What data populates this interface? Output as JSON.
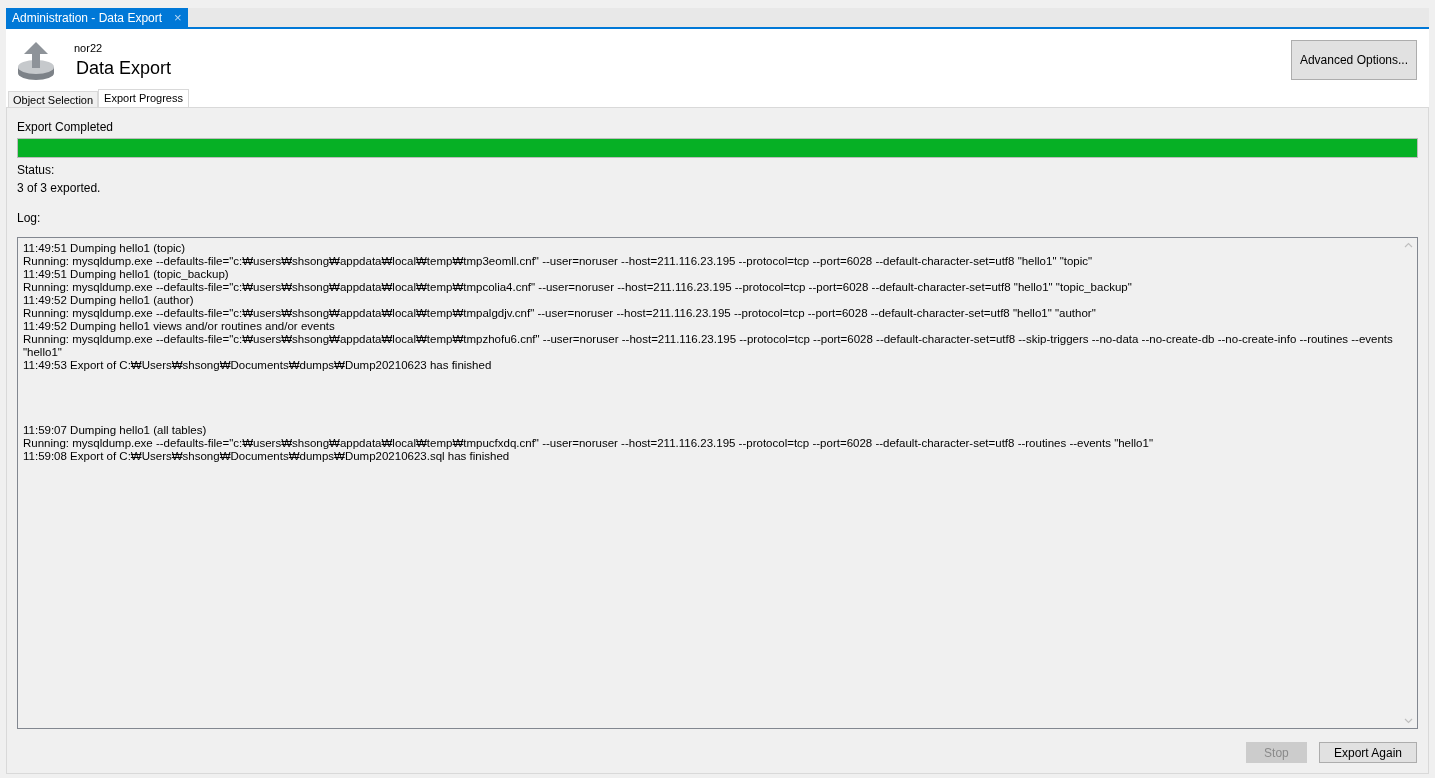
{
  "document_tab": {
    "title": "Administration - Data Export",
    "close": "×"
  },
  "header": {
    "connection": "nor22",
    "title": "Data Export",
    "advanced_button": "Advanced Options..."
  },
  "tabs": [
    {
      "label": "Object Selection",
      "selected": false
    },
    {
      "label": "Export Progress",
      "selected": true
    }
  ],
  "progress": {
    "label": "Export Completed",
    "level": 1
  },
  "status": {
    "label": "Status:",
    "value": "3 of 3 exported."
  },
  "log": {
    "label": "Log:",
    "sessions": [
      {
        "lines": [
          "11:49:51 Dumping hello1 (topic)",
          "Running: mysqldump.exe --defaults-file=\"c:₩users₩shsong₩appdata₩local₩temp₩tmp3eomll.cnf\"  --user=noruser --host=211.116.23.195 --protocol=tcp --port=6028 --default-character-set=utf8 \"hello1\" \"topic\"",
          "11:49:51 Dumping hello1 (topic_backup)",
          "Running: mysqldump.exe --defaults-file=\"c:₩users₩shsong₩appdata₩local₩temp₩tmpcolia4.cnf\"  --user=noruser --host=211.116.23.195 --protocol=tcp --port=6028 --default-character-set=utf8 \"hello1\" \"topic_backup\"",
          "11:49:52 Dumping hello1 (author)",
          "Running: mysqldump.exe --defaults-file=\"c:₩users₩shsong₩appdata₩local₩temp₩tmpalgdjv.cnf\"  --user=noruser --host=211.116.23.195 --protocol=tcp --port=6028 --default-character-set=utf8 \"hello1\" \"author\"",
          "11:49:52 Dumping hello1 views and/or routines and/or events",
          "Running: mysqldump.exe --defaults-file=\"c:₩users₩shsong₩appdata₩local₩temp₩tmpzhofu6.cnf\"  --user=noruser --host=211.116.23.195 --protocol=tcp --port=6028 --default-character-set=utf8 --skip-triggers  --no-data  --no-create-db --no-create-info --routines --events \"hello1\"",
          "11:49:53 Export of C:₩Users₩shsong₩Documents₩dumps₩Dump20210623 has finished"
        ]
      },
      {
        "lines": [
          "11:59:07 Dumping hello1 (all tables)",
          "Running: mysqldump.exe --defaults-file=\"c:₩users₩shsong₩appdata₩local₩temp₩tmpucfxdq.cnf\"  --user=noruser --host=211.116.23.195 --protocol=tcp --port=6028 --default-character-set=utf8 --routines --events \"hello1\"",
          "11:59:08 Export of C:₩Users₩shsong₩Documents₩dumps₩Dump20210623.sql has finished"
        ]
      }
    ]
  },
  "buttons": [
    {
      "label": "Stop",
      "disabled": true
    },
    {
      "label": "Export Again",
      "disabled": false
    }
  ]
}
